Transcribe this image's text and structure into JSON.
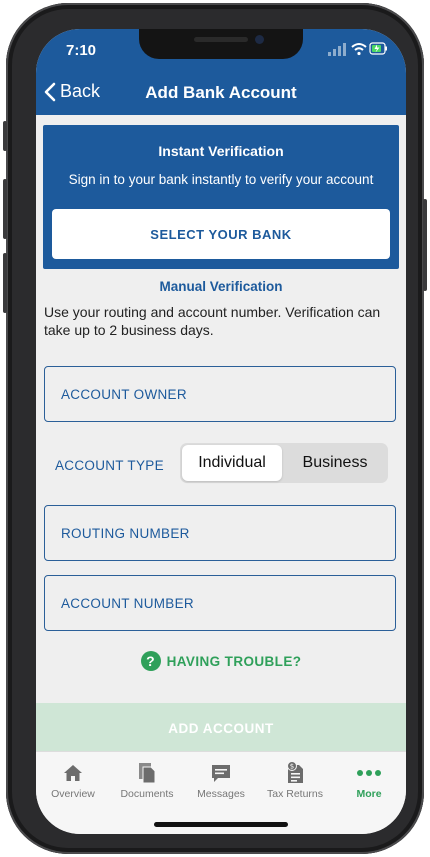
{
  "status": {
    "time": "7:10"
  },
  "nav": {
    "back_label": "Back",
    "title": "Add Bank Account"
  },
  "instant": {
    "title": "Instant Verification",
    "subtitle": "Sign in to your bank instantly to verify your account",
    "button_label": "SELECT YOUR BANK"
  },
  "manual": {
    "title": "Manual Verification",
    "description": "Use your routing and account number. Verification can take up to 2 business days."
  },
  "form": {
    "account_owner": "ACCOUNT OWNER",
    "account_type_label": "ACCOUNT TYPE",
    "account_type_options": [
      "Individual",
      "Business"
    ],
    "account_type_selected": "Individual",
    "routing_number": "ROUTING NUMBER",
    "account_number": "ACCOUNT NUMBER"
  },
  "help": {
    "trouble_label": "HAVING TROUBLE?"
  },
  "actions": {
    "add_account_label": "ADD ACCOUNT"
  },
  "tabs": [
    {
      "label": "Overview",
      "icon": "home-icon"
    },
    {
      "label": "Documents",
      "icon": "documents-icon"
    },
    {
      "label": "Messages",
      "icon": "messages-icon"
    },
    {
      "label": "Tax Returns",
      "icon": "tax-returns-icon"
    },
    {
      "label": "More",
      "icon": "more-icon",
      "active": true
    }
  ],
  "colors": {
    "primary": "#1d5a9c",
    "accent": "#2fa05a",
    "disabled": "#cfe6d6"
  }
}
